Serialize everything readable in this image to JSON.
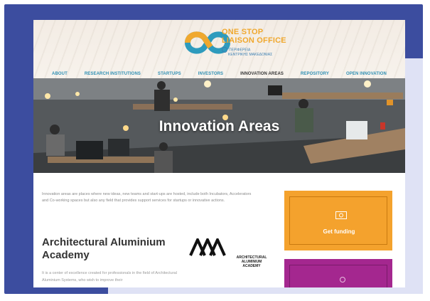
{
  "logo": {
    "title_line1": "ONE STOP",
    "title_line2": "LIAISON OFFICE",
    "subtitle_line1": "ΠΕΡΙΦΕΡΕΙΑ",
    "subtitle_line2": "ΚΕΝΤΡΙΚΗΣ ΜΑΚΕΔΟΝΙΑΣ"
  },
  "nav": {
    "items": [
      {
        "label": "ABOUT"
      },
      {
        "label": "RESEARCH INSTITUTIONS"
      },
      {
        "label": "STARTUPS"
      },
      {
        "label": "INVESTORS"
      },
      {
        "label": "INNOVATION AREAS"
      },
      {
        "label": "REPOSITORY"
      },
      {
        "label": "OPEN INNOVATION"
      }
    ],
    "active": "INNOVATION AREAS"
  },
  "hero": {
    "title": "Innovation Areas"
  },
  "content": {
    "intro": "Innovation areas are places where new ideas, new teams and start-ups are hosted, include both Incubators, Accelerators and Co-working spaces but also any field that provides support services for startups or innovative actions.",
    "section_title": "Architectural Aluminium Academy",
    "body": "It is a center of excellence created for professionals in the field of Architectural Aluminium Systems, who wish to improve their",
    "partner_logo_text": [
      "ARCHITECTURAL",
      "ALUMINIUM",
      "ACADEMY"
    ]
  },
  "sidebar": {
    "funding_label": "Get funding",
    "funding_icon": "money-icon",
    "purple_icon": "bulb-icon"
  },
  "colors": {
    "frame": "#3c4d9f",
    "accent_orange": "#f4a22d",
    "accent_purple": "#a4278f",
    "nav_link": "#2f8fb3"
  }
}
